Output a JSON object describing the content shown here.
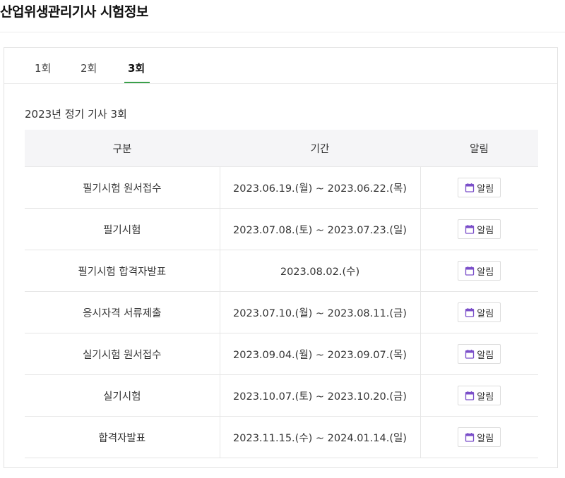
{
  "page": {
    "title": "산업위생관리기사 시험정보"
  },
  "tabs": [
    {
      "label": "1회",
      "active": false
    },
    {
      "label": "2회",
      "active": false
    },
    {
      "label": "3회",
      "active": true
    }
  ],
  "section_title": "2023년 정기 기사 3회",
  "table": {
    "headers": [
      "구분",
      "기간",
      "알림"
    ],
    "rows": [
      {
        "category": "필기시험 원서접수",
        "period": "2023.06.19.(월) ~ 2023.06.22.(목)"
      },
      {
        "category": "필기시험",
        "period": "2023.07.08.(토) ~ 2023.07.23.(일)"
      },
      {
        "category": "필기시험 합격자발표",
        "period": "2023.08.02.(수)"
      },
      {
        "category": "응시자격 서류제출",
        "period": "2023.07.10.(월) ~ 2023.08.11.(금)"
      },
      {
        "category": "실기시험 원서접수",
        "period": "2023.09.04.(월) ~ 2023.09.07.(목)"
      },
      {
        "category": "실기시험",
        "period": "2023.10.07.(토) ~ 2023.10.20.(금)"
      },
      {
        "category": "합격자발표",
        "period": "2023.11.15.(수) ~ 2024.01.14.(일)"
      }
    ],
    "alarm_label": "알림",
    "alarm_icon": "calendar-icon"
  },
  "colors": {
    "active_tab_underline": "#3aa04a",
    "calendar_icon": "#7b4fc9"
  }
}
